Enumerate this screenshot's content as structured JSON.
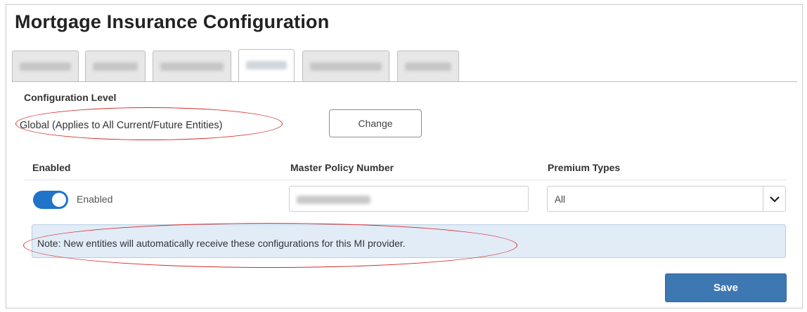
{
  "page": {
    "title": "Mortgage Insurance Configuration"
  },
  "tabs": [
    {
      "label": "",
      "redacted": true
    },
    {
      "label": "",
      "redacted": true
    },
    {
      "label": "",
      "redacted": true
    },
    {
      "label": "",
      "redacted": true,
      "active": true
    },
    {
      "label": "",
      "redacted": true
    },
    {
      "label": "",
      "redacted": true
    }
  ],
  "configuration": {
    "label": "Configuration Level",
    "value": "Global (Applies to All Current/Future Entities)",
    "change_label": "Change"
  },
  "columns": {
    "enabled": "Enabled",
    "master_policy": "Master Policy Number",
    "premium_types": "Premium Types"
  },
  "row": {
    "enabled_state": true,
    "enabled_label": "Enabled",
    "master_policy_value": "",
    "premium_types_value": "All"
  },
  "note": {
    "text": "Note: New entities will automatically receive these configurations for this MI provider."
  },
  "actions": {
    "save_label": "Save"
  },
  "icons": {
    "select_chevron": "chevron-down-icon"
  },
  "colors": {
    "accent": "#1f74c9",
    "save_button": "#3e78b3",
    "note_background": "#e1ecf7",
    "annotation": "#d42a2a"
  }
}
